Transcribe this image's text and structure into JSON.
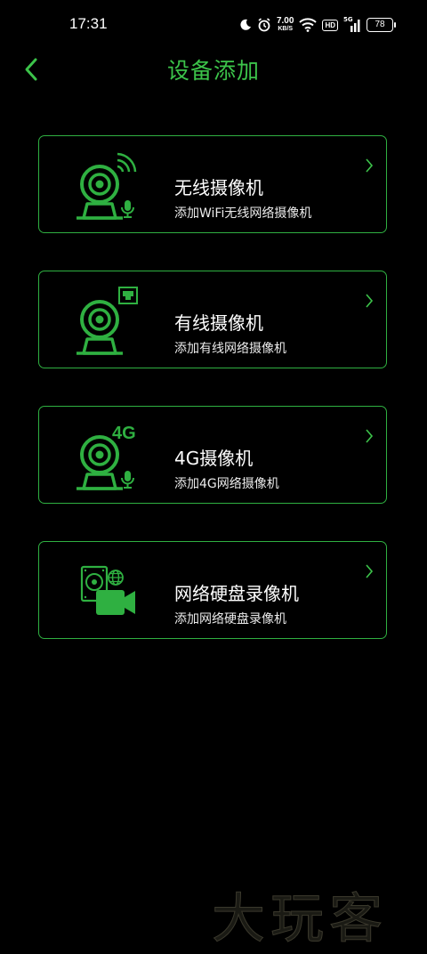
{
  "status_bar": {
    "time": "17:31",
    "net_speed": "7.00",
    "net_speed_unit": "KB/S",
    "hd_label": "HD",
    "network_label": "5G",
    "battery": "78",
    "icons": [
      "moon-icon",
      "alarm-icon",
      "wifi-icon",
      "hd-icon",
      "signal-icon",
      "battery-icon"
    ]
  },
  "header": {
    "title": "设备添加",
    "back_icon": "chevron-left-icon"
  },
  "accent_color": "#3cc34a",
  "devices": [
    {
      "title": "无线摄像机",
      "subtitle": "添加WiFi无线网络摄像机",
      "icon": "wireless-camera-icon"
    },
    {
      "title": "有线摄像机",
      "subtitle": "添加有线网络摄像机",
      "icon": "wired-camera-icon"
    },
    {
      "title": "4G摄像机",
      "subtitle": "添加4G网络摄像机",
      "icon": "4g-camera-icon",
      "icon_label": "4G"
    },
    {
      "title": "网络硬盘录像机",
      "subtitle": "添加网络硬盘录像机",
      "icon": "nvr-recorder-icon"
    }
  ],
  "watermark": "大玩客"
}
